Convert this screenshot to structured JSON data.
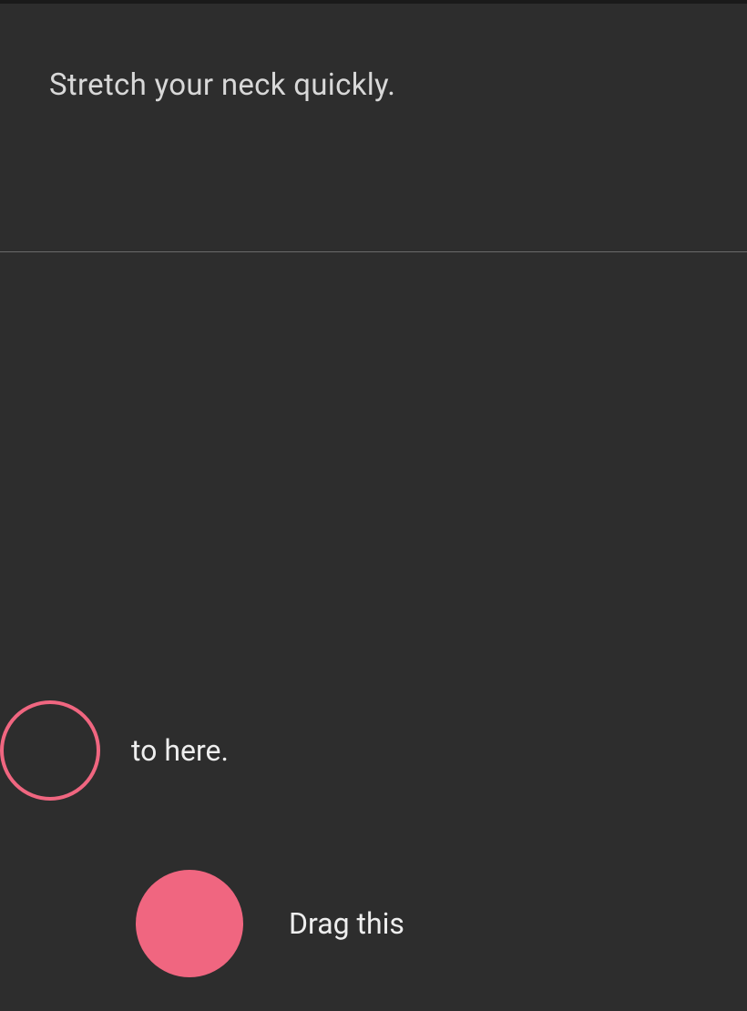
{
  "instruction": {
    "text": "Stretch your neck quickly."
  },
  "target": {
    "label": "to here."
  },
  "drag": {
    "label": "Drag this"
  },
  "colors": {
    "accent": "#f06680",
    "background": "#2d2d2d",
    "text_primary": "#d8d8d8",
    "text_secondary": "#eeeeee"
  }
}
